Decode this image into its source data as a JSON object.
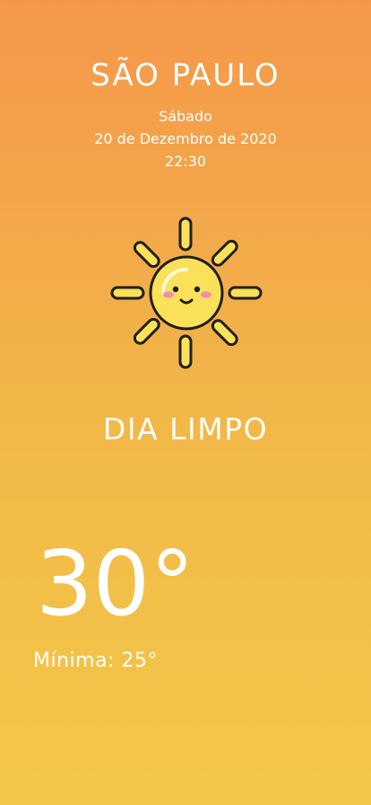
{
  "location": {
    "city": "SÃO PAULO",
    "weekday": "Sábado",
    "date": "20 de Dezembro de 2020",
    "time": "22:30"
  },
  "weather": {
    "icon": "sun-icon",
    "condition": "DIA LIMPO",
    "temperature": "30°",
    "minimum_label": "Mínima: 25°"
  },
  "colors": {
    "gradient_top": "#f4974a",
    "gradient_bottom": "#f3c848",
    "sun_fill": "#fbe15a",
    "outline": "#1f1f1f",
    "cheek": "#f28cb3"
  }
}
